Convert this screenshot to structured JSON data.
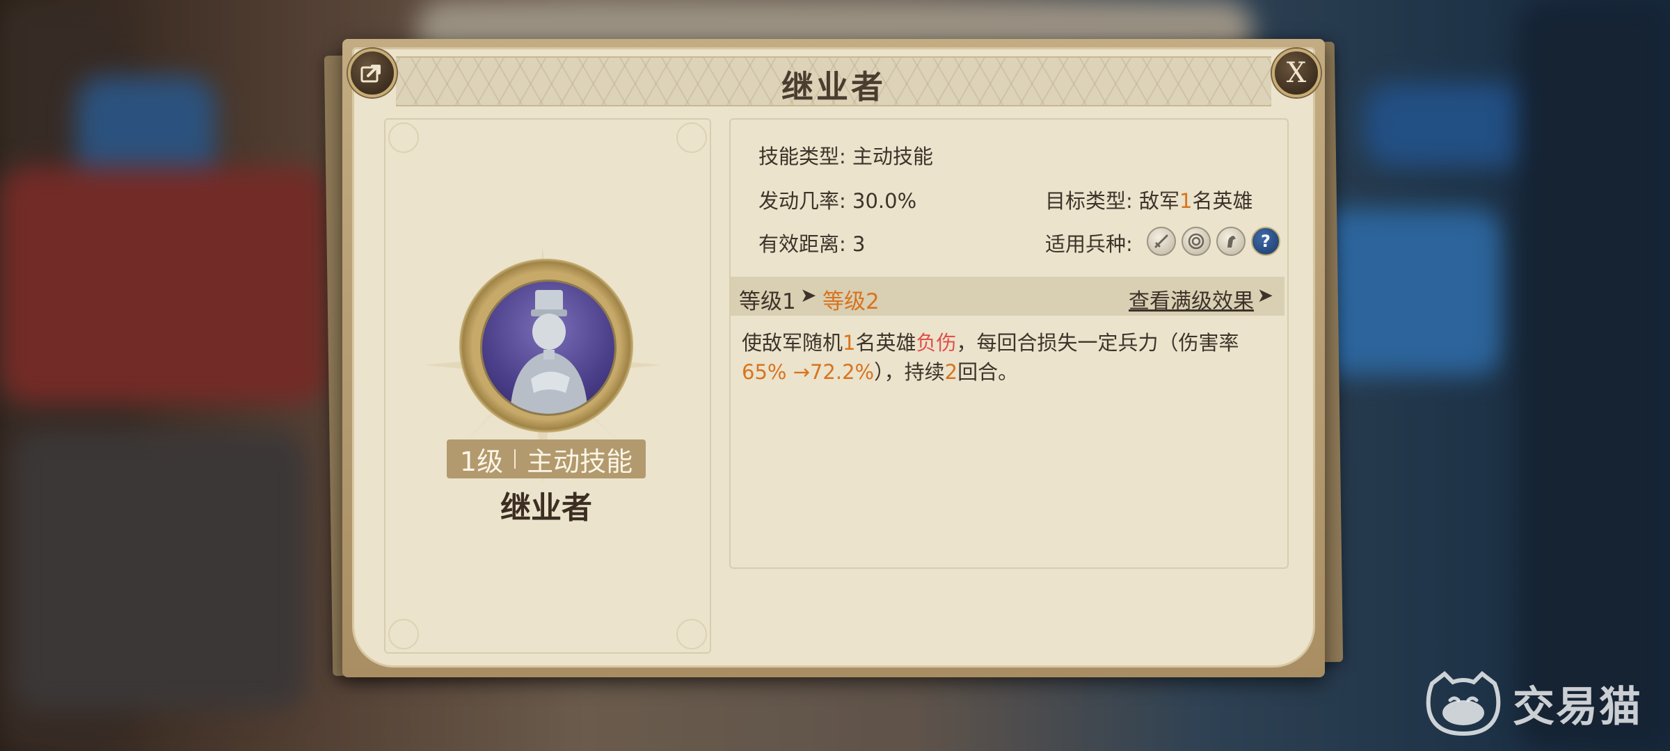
{
  "dialog": {
    "title": "继业者",
    "close_label": "X"
  },
  "skill": {
    "level_tag": "1级",
    "type_tag": "主动技能",
    "name": "继业者"
  },
  "info": {
    "skill_type_label": "技能类型:",
    "skill_type_value": "主动技能",
    "trigger_rate_label": "发动几率:",
    "trigger_rate_value": "30.0%",
    "range_label": "有效距离:",
    "range_value": "3",
    "target_label": "目标类型:",
    "target_prefix": "敌军",
    "target_count": "1",
    "target_suffix": "名英雄",
    "troops_label": "适用兵种:",
    "troop_icons": [
      "sword-icon",
      "bow-target-icon",
      "horse-icon",
      "question-icon"
    ],
    "troop_question": "?"
  },
  "level_bar": {
    "from": "等级1",
    "arrow": "➤",
    "to": "等级2",
    "view_max": "查看满级效果",
    "view_max_arrow": "➤"
  },
  "description": {
    "p1": "使敌军随机",
    "n1": "1",
    "p2": "名英雄",
    "status": "负伤",
    "p3": "，每回合损失一定兵力（伤害率",
    "rate": "65% →72.2%",
    "p4": "），持续",
    "n2": "2",
    "p5": "回合。"
  },
  "watermark": {
    "text": "交易猫"
  },
  "colors": {
    "accent_orange": "#d8741e",
    "status_red": "#e0504a",
    "panel_bg": "#ebe3cc",
    "frame_gold": "#c7ad74"
  }
}
